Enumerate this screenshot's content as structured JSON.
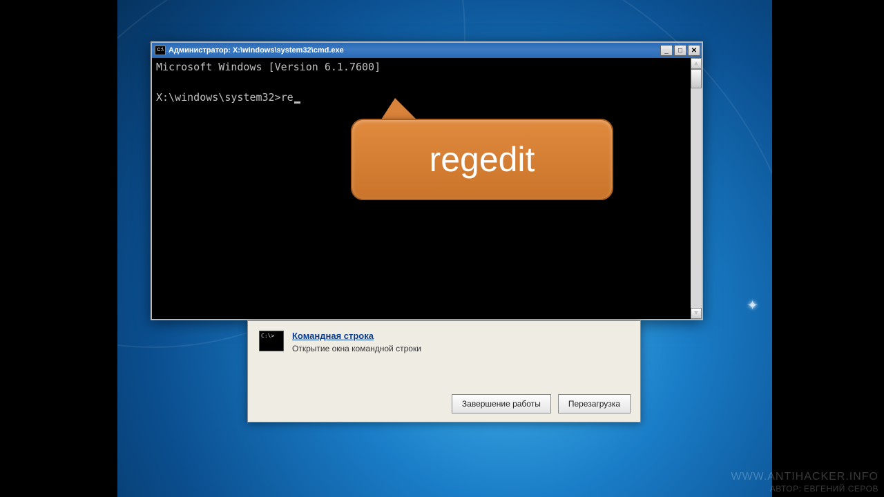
{
  "cmd": {
    "title": "Администратор: X:\\windows\\system32\\cmd.exe",
    "line1": "Microsoft Windows [Version 6.1.7600]",
    "prompt": "X:\\windows\\system32>",
    "typed": "re"
  },
  "callout": {
    "text": "regedit"
  },
  "panel": {
    "link_label": "Командная строка",
    "description": "Открытие окна командной строки",
    "shutdown_label": "Завершение работы",
    "restart_label": "Перезагрузка"
  },
  "titlebar_buttons": {
    "minimize": "_",
    "maximize": "□",
    "close": "✕"
  },
  "watermark": {
    "line1": "WWW.ANTIHACKER.INFO",
    "line2": "АВТОР: ЕВГЕНИЙ СЕРОВ"
  }
}
